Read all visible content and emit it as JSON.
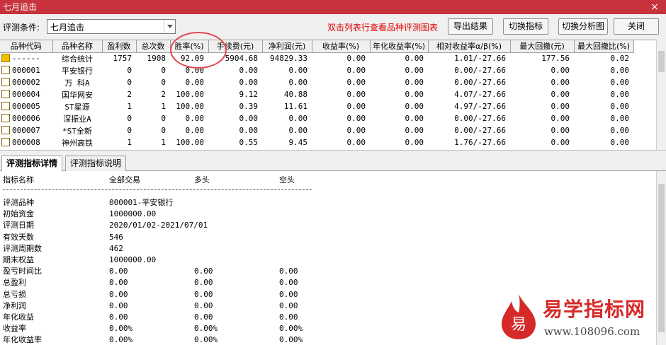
{
  "window": {
    "title": "七月追击"
  },
  "toolbar": {
    "condition_label": "评测条件:",
    "condition_value": "七月追击",
    "hint": "双击列表行查看品种评测图表",
    "export_label": "导出结果",
    "switch_indicator_label": "切换指标",
    "switch_chart_label": "切换分析图",
    "close_label": "关闭"
  },
  "grid": {
    "columns": [
      "品种代码",
      "品种名称",
      "盈利数",
      "总次数",
      "胜率(%)",
      "手续费(元)",
      "净利润(元)",
      "收益率(%)",
      "年化收益率(%)",
      "相对收益率α/β(%)",
      "最大回撤(元)",
      "最大回撤比(%)"
    ],
    "rows": [
      [
        "------",
        "综合统计",
        "1757",
        "1908",
        "92.09",
        "5904.68",
        "94829.33",
        "0.00",
        "0.00",
        "1.01/-27.66",
        "177.56",
        "0.02"
      ],
      [
        "000001",
        "平安银行",
        "0",
        "0",
        "0.00",
        "0.00",
        "0.00",
        "0.00",
        "0.00",
        "0.00/-27.66",
        "0.00",
        "0.00"
      ],
      [
        "000002",
        "万 科A",
        "0",
        "0",
        "0.00",
        "0.00",
        "0.00",
        "0.00",
        "0.00",
        "0.00/-27.66",
        "0.00",
        "0.00"
      ],
      [
        "000004",
        "国华网安",
        "2",
        "2",
        "100.00",
        "9.12",
        "40.88",
        "0.00",
        "0.00",
        "4.07/-27.66",
        "0.00",
        "0.00"
      ],
      [
        "000005",
        "ST星源",
        "1",
        "1",
        "100.00",
        "0.39",
        "11.61",
        "0.00",
        "0.00",
        "4.97/-27.66",
        "0.00",
        "0.00"
      ],
      [
        "000006",
        "深振业A",
        "0",
        "0",
        "0.00",
        "0.00",
        "0.00",
        "0.00",
        "0.00",
        "0.00/-27.66",
        "0.00",
        "0.00"
      ],
      [
        "000007",
        "*ST全新",
        "0",
        "0",
        "0.00",
        "0.00",
        "0.00",
        "0.00",
        "0.00",
        "0.00/-27.66",
        "0.00",
        "0.00"
      ],
      [
        "000008",
        "神州高铁",
        "1",
        "1",
        "100.00",
        "0.55",
        "9.45",
        "0.00",
        "0.00",
        "1.76/-27.66",
        "0.00",
        "0.00"
      ]
    ]
  },
  "tabs": [
    {
      "label": "评测指标详情",
      "active": true
    },
    {
      "label": "评测指标说明",
      "active": false
    }
  ],
  "detail": {
    "headers": [
      "指标名称",
      "全部交易",
      "多头",
      "空头"
    ],
    "rows": [
      [
        "评测品种",
        "000001-平安银行",
        "",
        ""
      ],
      [
        "初始资金",
        "1000000.00",
        "",
        ""
      ],
      [
        "评测日期",
        "2020/01/02-2021/07/01",
        "",
        ""
      ],
      [
        "有效天数",
        "546",
        "",
        ""
      ],
      [
        "评测周期数",
        "462",
        "",
        ""
      ],
      [
        "期末权益",
        "1000000.00",
        "",
        ""
      ],
      [
        "盈亏时间比",
        "0.00",
        "0.00",
        "0.00"
      ],
      [
        "总盈利",
        "0.00",
        "0.00",
        "0.00"
      ],
      [
        "总亏损",
        "0.00",
        "0.00",
        "0.00"
      ],
      [
        "净利润",
        "0.00",
        "0.00",
        "0.00"
      ],
      [
        "年化收益",
        "0.00",
        "0.00",
        "0.00"
      ],
      [
        "收益率",
        "0.00%",
        "0.00%",
        "0.00%"
      ],
      [
        "年化收益率",
        "0.00%",
        "0.00%",
        "0.00%"
      ]
    ]
  },
  "watermark": {
    "brand": "易学指标网",
    "url": "www.108096.com",
    "glyph": "易"
  },
  "colors": {
    "titlebar": "#c7323c",
    "hint": "#e00000",
    "annotation_circle": "#e6484e",
    "brand": "#d62a2a"
  }
}
